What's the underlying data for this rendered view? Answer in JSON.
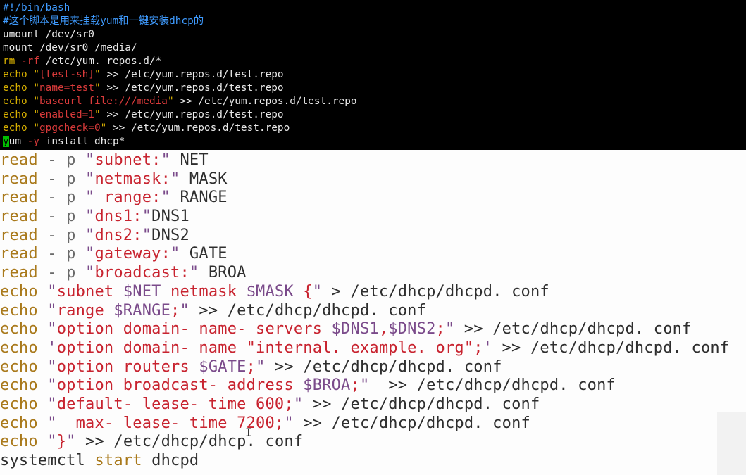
{
  "top_pane": {
    "background": "#000000",
    "lines": [
      [
        {
          "t": "#!/bin/bash",
          "c": "comment"
        }
      ],
      [
        {
          "t": "#这个脚本是用来挂载yum和一键安装dhcp的",
          "c": "comment"
        }
      ],
      [
        {
          "t": "umount /dev/sr0",
          "c": "plain"
        }
      ],
      [
        {
          "t": "mount /dev/sr0 /media/",
          "c": "plain"
        }
      ],
      [
        {
          "t": "rm",
          "c": "kw"
        },
        {
          "t": " ",
          "c": "plain"
        },
        {
          "t": "-rf",
          "c": "opt"
        },
        {
          "t": " /etc/yum. repos.d/*",
          "c": "plain"
        }
      ],
      [
        {
          "t": "echo",
          "c": "kw"
        },
        {
          "t": " ",
          "c": "plain"
        },
        {
          "t": "\"",
          "c": "str-q"
        },
        {
          "t": "[test-sh]",
          "c": "str"
        },
        {
          "t": "\"",
          "c": "str-q"
        },
        {
          "t": " >> /etc/yum.repos.d/test.repo",
          "c": "plain"
        }
      ],
      [
        {
          "t": "echo",
          "c": "kw"
        },
        {
          "t": " ",
          "c": "plain"
        },
        {
          "t": "\"",
          "c": "str-q"
        },
        {
          "t": "name=test",
          "c": "str"
        },
        {
          "t": "\"",
          "c": "str-q"
        },
        {
          "t": " >> /etc/yum.repos.d/test.repo",
          "c": "plain"
        }
      ],
      [
        {
          "t": "echo",
          "c": "kw"
        },
        {
          "t": " ",
          "c": "plain"
        },
        {
          "t": "\"",
          "c": "str-q"
        },
        {
          "t": "baseurl file:///media",
          "c": "str"
        },
        {
          "t": "\"",
          "c": "str-q"
        },
        {
          "t": " >> /etc/yum.repos.d/test.repo",
          "c": "plain"
        }
      ],
      [
        {
          "t": "echo",
          "c": "kw"
        },
        {
          "t": " ",
          "c": "plain"
        },
        {
          "t": "\"",
          "c": "str-q"
        },
        {
          "t": "enabled=1",
          "c": "str"
        },
        {
          "t": "\"",
          "c": "str-q"
        },
        {
          "t": " >> /etc/yum.repos.d/test.repo",
          "c": "plain"
        }
      ],
      [
        {
          "t": "echo",
          "c": "kw"
        },
        {
          "t": " ",
          "c": "plain"
        },
        {
          "t": "\"",
          "c": "str-q"
        },
        {
          "t": "gpgcheck=0",
          "c": "str"
        },
        {
          "t": "\"",
          "c": "str-q"
        },
        {
          "t": " >> /etc/yum.repos.d/test.repo",
          "c": "plain"
        }
      ],
      [
        {
          "t": "y",
          "c": "cursor"
        },
        {
          "t": "um",
          "c": "plain"
        },
        {
          "t": " ",
          "c": "plain"
        },
        {
          "t": "-y",
          "c": "opt"
        },
        {
          "t": " install dhcp*",
          "c": "plain"
        }
      ]
    ]
  },
  "bottom_pane": {
    "background": "#fdfdfd",
    "lines": [
      [
        {
          "t": "read",
          "c": "kw"
        },
        {
          "t": " - p ",
          "c": "opt"
        },
        {
          "t": "\"",
          "c": "str-q"
        },
        {
          "t": "subnet:",
          "c": "str"
        },
        {
          "t": "\"",
          "c": "str-q"
        },
        {
          "t": " NET",
          "c": "plain"
        }
      ],
      [
        {
          "t": "read",
          "c": "kw"
        },
        {
          "t": " - p ",
          "c": "opt"
        },
        {
          "t": "\"",
          "c": "str-q"
        },
        {
          "t": "netmask:",
          "c": "str"
        },
        {
          "t": "\"",
          "c": "str-q"
        },
        {
          "t": " MASK",
          "c": "plain"
        }
      ],
      [
        {
          "t": "read",
          "c": "kw"
        },
        {
          "t": " - p ",
          "c": "opt"
        },
        {
          "t": "\"",
          "c": "str-q"
        },
        {
          "t": " range:",
          "c": "str"
        },
        {
          "t": "\"",
          "c": "str-q"
        },
        {
          "t": " RANGE",
          "c": "plain"
        }
      ],
      [
        {
          "t": "read",
          "c": "kw"
        },
        {
          "t": " - p ",
          "c": "opt"
        },
        {
          "t": "\"",
          "c": "str-q"
        },
        {
          "t": "dns1:",
          "c": "str"
        },
        {
          "t": "\"",
          "c": "str-q"
        },
        {
          "t": "DNS1",
          "c": "plain"
        }
      ],
      [
        {
          "t": "read",
          "c": "kw"
        },
        {
          "t": " - p ",
          "c": "opt"
        },
        {
          "t": "\"",
          "c": "str-q"
        },
        {
          "t": "dns2:",
          "c": "str"
        },
        {
          "t": "\"",
          "c": "str-q"
        },
        {
          "t": "DNS2",
          "c": "plain"
        }
      ],
      [
        {
          "t": "read",
          "c": "kw"
        },
        {
          "t": " - p ",
          "c": "opt"
        },
        {
          "t": "\"",
          "c": "str-q"
        },
        {
          "t": "gateway:",
          "c": "str"
        },
        {
          "t": "\"",
          "c": "str-q"
        },
        {
          "t": " GATE",
          "c": "plain"
        }
      ],
      [
        {
          "t": "read",
          "c": "kw"
        },
        {
          "t": " - p ",
          "c": "opt"
        },
        {
          "t": "\"",
          "c": "str-q"
        },
        {
          "t": "broadcast:",
          "c": "str"
        },
        {
          "t": "\"",
          "c": "str-q"
        },
        {
          "t": " BROA",
          "c": "plain"
        }
      ],
      [
        {
          "t": "echo",
          "c": "kw"
        },
        {
          "t": " ",
          "c": "plain"
        },
        {
          "t": "\"",
          "c": "str-q"
        },
        {
          "t": "subnet ",
          "c": "str"
        },
        {
          "t": "$NET",
          "c": "var"
        },
        {
          "t": " netmask ",
          "c": "str"
        },
        {
          "t": "$MASK",
          "c": "var"
        },
        {
          "t": " {",
          "c": "str"
        },
        {
          "t": "\"",
          "c": "str-q"
        },
        {
          "t": " > /etc/dhcp/dhcpd. conf",
          "c": "plain"
        }
      ],
      [
        {
          "t": "echo",
          "c": "kw"
        },
        {
          "t": " ",
          "c": "plain"
        },
        {
          "t": "\"",
          "c": "str-q"
        },
        {
          "t": "range ",
          "c": "str"
        },
        {
          "t": "$RANGE",
          "c": "var"
        },
        {
          "t": ";",
          "c": "str"
        },
        {
          "t": "\"",
          "c": "str-q"
        },
        {
          "t": " >> /etc/dhcp/dhcpd. conf",
          "c": "plain"
        }
      ],
      [
        {
          "t": "echo",
          "c": "kw"
        },
        {
          "t": " ",
          "c": "plain"
        },
        {
          "t": "\"",
          "c": "str-q"
        },
        {
          "t": "option domain- name- servers ",
          "c": "str"
        },
        {
          "t": "$DNS1",
          "c": "var"
        },
        {
          "t": ",",
          "c": "str"
        },
        {
          "t": "$DNS2",
          "c": "var"
        },
        {
          "t": ";",
          "c": "str"
        },
        {
          "t": "\"",
          "c": "str-q"
        },
        {
          "t": " >> /etc/dhcp/dhcpd. conf",
          "c": "plain"
        }
      ],
      [
        {
          "t": "echo",
          "c": "kw"
        },
        {
          "t": " ",
          "c": "plain"
        },
        {
          "t": "'",
          "c": "str-q"
        },
        {
          "t": "option domain- name \"internal. example. org\";",
          "c": "str"
        },
        {
          "t": "'",
          "c": "str-q"
        },
        {
          "t": " >> /etc/dhcp/dhcpd. conf",
          "c": "plain"
        }
      ],
      [
        {
          "t": "echo",
          "c": "kw"
        },
        {
          "t": " ",
          "c": "plain"
        },
        {
          "t": "\"",
          "c": "str-q"
        },
        {
          "t": "option routers ",
          "c": "str"
        },
        {
          "t": "$GATE",
          "c": "var"
        },
        {
          "t": ";",
          "c": "str"
        },
        {
          "t": "\"",
          "c": "str-q"
        },
        {
          "t": " >> /etc/dhcp/dhcpd. conf",
          "c": "plain"
        }
      ],
      [
        {
          "t": "echo",
          "c": "kw"
        },
        {
          "t": " ",
          "c": "plain"
        },
        {
          "t": "\"",
          "c": "str-q"
        },
        {
          "t": "option broadcast- address ",
          "c": "str"
        },
        {
          "t": "$BROA",
          "c": "var"
        },
        {
          "t": ";",
          "c": "str"
        },
        {
          "t": "\"",
          "c": "str-q"
        },
        {
          "t": "  >> /etc/dhcp/dhcpd. conf",
          "c": "plain"
        }
      ],
      [
        {
          "t": "echo",
          "c": "kw"
        },
        {
          "t": " ",
          "c": "plain"
        },
        {
          "t": "\"",
          "c": "str-q"
        },
        {
          "t": "default- lease- time 600;",
          "c": "str"
        },
        {
          "t": "\"",
          "c": "str-q"
        },
        {
          "t": " >> /etc/dhcp/dhcpd. conf",
          "c": "plain"
        }
      ],
      [
        {
          "t": "echo",
          "c": "kw"
        },
        {
          "t": " ",
          "c": "plain"
        },
        {
          "t": "\"",
          "c": "str-q"
        },
        {
          "t": "  max- lease- time 7200;",
          "c": "str"
        },
        {
          "t": "\"",
          "c": "str-q"
        },
        {
          "t": " >> /etc/dhcp/dhcpd. conf",
          "c": "plain"
        }
      ],
      [
        {
          "t": "echo",
          "c": "kw"
        },
        {
          "t": " ",
          "c": "plain"
        },
        {
          "t": "\"",
          "c": "str-q"
        },
        {
          "t": "}",
          "c": "str"
        },
        {
          "t": "\"",
          "c": "str-q"
        },
        {
          "t": " >> /etc/dhcp/dhcp. conf",
          "c": "plain"
        }
      ],
      [
        {
          "t": "systemctl",
          "c": "plain"
        },
        {
          "t": " start",
          "c": "kw"
        },
        {
          "t": " dhcpd",
          "c": "plain"
        }
      ]
    ]
  },
  "mouse_cursor_glyph": "I"
}
